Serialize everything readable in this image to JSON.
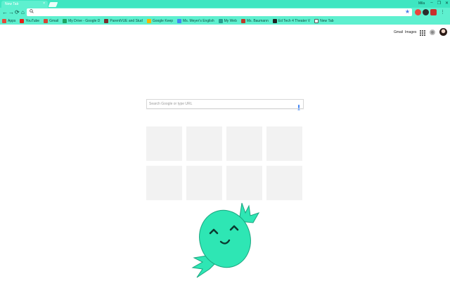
{
  "browser": {
    "tab_title": "New Tab",
    "tab_close": "×",
    "profile_name": "Mila",
    "window_controls": [
      "–",
      "❐",
      "✕"
    ]
  },
  "toolbar": {
    "back": "←",
    "forward": "→",
    "reload": "⟳",
    "home": "⌂",
    "omnibox_value": "",
    "star": "★"
  },
  "bookmarks": [
    {
      "label": "Apps",
      "icon_color": "#e34b3b"
    },
    {
      "label": "YouTube",
      "icon_color": "#e62117"
    },
    {
      "label": "Gmail",
      "icon_color": "#d44638"
    },
    {
      "label": "My Drive - Google D",
      "icon_color": "#1fa463"
    },
    {
      "label": "ParentVUE and Stud",
      "icon_color": "#7a2e2e"
    },
    {
      "label": "Google Keep",
      "icon_color": "#f7b500"
    },
    {
      "label": "Ms. Meyer's English",
      "icon_color": "#4285f4"
    },
    {
      "label": "My Web",
      "icon_color": "#2a9d8f"
    },
    {
      "label": "Ms. Baumann",
      "icon_color": "#c0392b"
    },
    {
      "label": "Ed Tech 4 Theater V",
      "icon_color": "#222222"
    },
    {
      "label": "New Tab",
      "icon_color": "#ffffff"
    }
  ],
  "header": {
    "gmail": "Gmail",
    "images": "Images"
  },
  "search": {
    "placeholder": "Search Google or type URL",
    "value": ""
  },
  "tiles_count": 8,
  "colors": {
    "theme": "#3ee6c1",
    "theme_light": "#5ef0cf",
    "mascot": "#2ee6b4",
    "mascot_dark": "#1aa57f"
  }
}
